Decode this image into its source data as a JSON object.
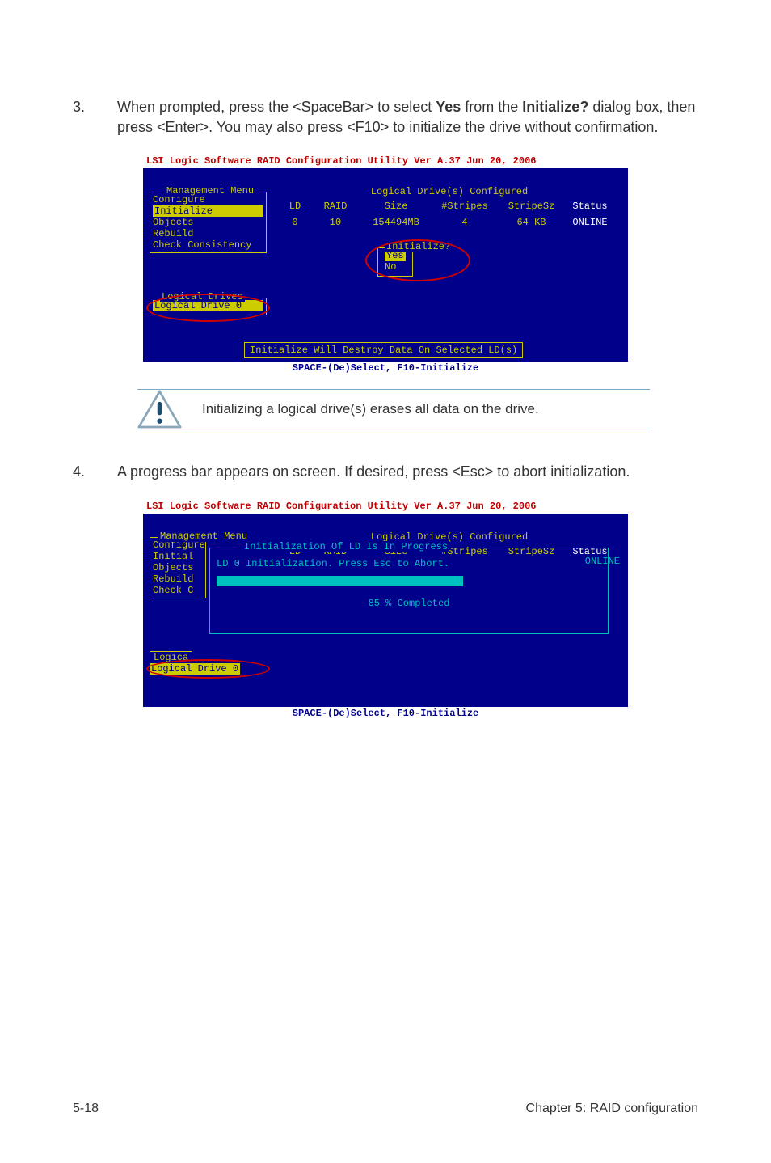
{
  "steps": {
    "s3": {
      "num": "3.",
      "text_pre": "When prompted, press the <SpaceBar> to select ",
      "yes": "Yes",
      "text_mid1": " from the ",
      "initq": "Initialize?",
      "text_mid2": " dialog box, then press <Enter>. You may also press <F10> to initialize the drive without confirmation."
    },
    "s4": {
      "num": "4.",
      "text": "A progress bar appears on screen. If desired, press <Esc> to abort initialization."
    }
  },
  "bios1": {
    "title": "LSI Logic Software RAID Configuration Utility Ver A.37 Jun 20, 2006",
    "menu_title": "Management Menu",
    "menu_items": [
      "Configure",
      "Initialize",
      "Objects",
      "Rebuild",
      "Check Consistency"
    ],
    "drives_title": "Logical Drives",
    "drives_item": "Logical Drive 0",
    "table_title": "Logical Drive(s) Configured",
    "headers": {
      "ld": "LD",
      "raid": "RAID",
      "size": "Size",
      "stripes": "#Stripes",
      "stripesz": "StripeSz",
      "status": "Status"
    },
    "row": {
      "ld": "0",
      "raid": "10",
      "size": "154494MB",
      "stripes": "4",
      "stripesz": "64  KB",
      "status": "ONLINE"
    },
    "dialog_title": "Initialize?",
    "dialog_yes": "Yes",
    "dialog_no": "No",
    "warn": "Initialize Will Destroy Data On Selected LD(s)",
    "bottombar": "SPACE-(De)Select,  F10-Initialize"
  },
  "note_text": "Initializing a logical drive(s) erases all data on the drive.",
  "bios2": {
    "title": "LSI Logic Software RAID Configuration Utility Ver A.37 Jun 20, 2006",
    "menu_title": "Management Menu",
    "menu_items": [
      "Configure",
      "Initial",
      "Objects",
      "Rebuild",
      "Check C"
    ],
    "table_title": "Logical Drive(s) Configured",
    "headers": {
      "ld": "LD",
      "raid": "RAID",
      "size": "Size",
      "stripes": "#Stripes",
      "stripesz": "StripeSz",
      "status": "Status"
    },
    "progress_title": "Initialization Of LD Is In Progress",
    "progress_msg": "LD 0 Initialization. Press Esc to Abort.",
    "percent": "85 % Completed",
    "online": "ONLINE",
    "logica": "Logica",
    "logica_drive": "Logical Drive 0",
    "bottombar": "SPACE-(De)Select,  F10-Initialize"
  },
  "footer": {
    "left": "5-18",
    "right": "Chapter 5: RAID configuration"
  }
}
